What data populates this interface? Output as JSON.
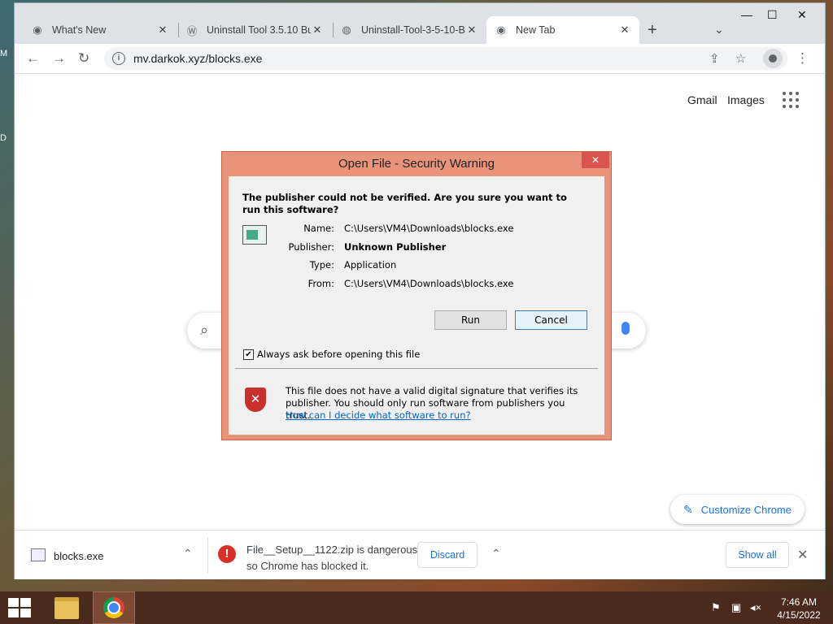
{
  "desktop_edge": [
    "M",
    "D"
  ],
  "tabs": [
    {
      "title": "What's New",
      "icon": "chrome-icon"
    },
    {
      "title": "Uninstall Tool 3.5.10 Bu",
      "icon": "wordpress-icon"
    },
    {
      "title": "Uninstall-Tool-3-5-10-B",
      "icon": "globe-icon"
    },
    {
      "title": "New Tab",
      "icon": "chrome-icon"
    }
  ],
  "address": {
    "url": "mv.darkok.xyz/blocks.exe"
  },
  "ntp": {
    "gmail": "Gmail",
    "images": "Images",
    "customize": "Customize Chrome"
  },
  "dialog": {
    "title": "Open File - Security Warning",
    "question": "The publisher could not be verified.  Are you sure you want to run this software?",
    "fields": [
      {
        "label": "Name:",
        "value": "C:\\Users\\VM4\\Downloads\\blocks.exe"
      },
      {
        "label": "Publisher:",
        "value": "Unknown Publisher"
      },
      {
        "label": "Type:",
        "value": "Application"
      },
      {
        "label": "From:",
        "value": "C:\\Users\\VM4\\Downloads\\blocks.exe"
      }
    ],
    "run": "Run",
    "cancel": "Cancel",
    "checkbox_label": "Always ask before opening this file",
    "checkbox_checked": true,
    "note": "This file does not have a valid digital signature that verifies its publisher.  You should only run software from publishers you trust.",
    "link": "How can I decide what software to run?"
  },
  "downloads": {
    "file1": "blocks.exe",
    "warning_line1": "File__Setup__1122.zip is dangerous,",
    "warning_line2": "so Chrome has blocked it.",
    "discard": "Discard",
    "show_all": "Show all"
  },
  "taskbar": {
    "time": "7:46 AM",
    "date": "4/15/2022"
  },
  "colors": {
    "dialog_frame": "#e9947a",
    "link_blue": "#1a73e8",
    "danger_red": "#d93025",
    "taskbar": "#4a2a1c"
  }
}
